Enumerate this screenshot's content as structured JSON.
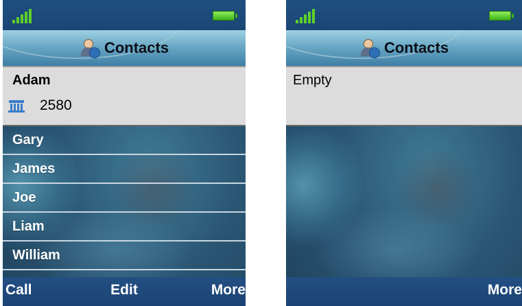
{
  "screens": [
    {
      "title": "Contacts",
      "selected": {
        "name": "Adam",
        "number": "2580",
        "number_type_icon": "work-building-icon"
      },
      "contacts": [
        "Gary",
        "James",
        "Joe",
        "Liam",
        "William"
      ],
      "softkeys": {
        "left": "Call",
        "center": "Edit",
        "right": "More"
      }
    },
    {
      "title": "Contacts",
      "empty_text": "Empty",
      "softkeys": {
        "right": "More"
      }
    }
  ],
  "status": {
    "signal_icon": "signal-strength-icon",
    "battery_icon": "battery-icon"
  },
  "colors": {
    "accent": "#1f4f7f",
    "signal": "#5fd12a",
    "battery": "#3fb11a",
    "selected_bg": "#dcdcdc"
  }
}
